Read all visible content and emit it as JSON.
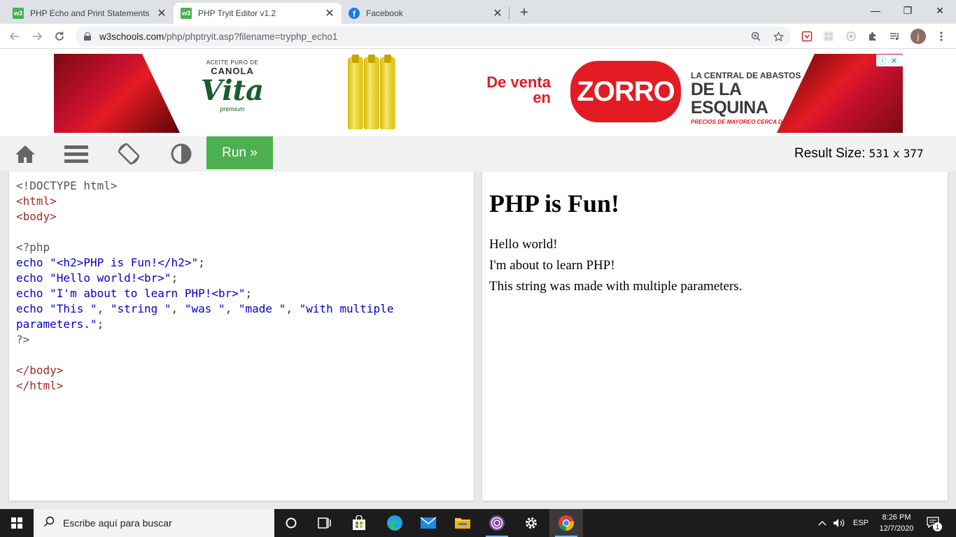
{
  "browser": {
    "tabs": [
      {
        "title": "PHP Echo and Print Statements",
        "favicon": "w3schools-icon",
        "active": false
      },
      {
        "title": "PHP Tryit Editor v1.2",
        "favicon": "w3schools-icon",
        "active": true
      },
      {
        "title": "Facebook",
        "favicon": "facebook-icon",
        "active": false
      }
    ],
    "favicon_w3_text": "w3",
    "favicon_fb_text": "f",
    "new_tab_label": "+",
    "close_glyph": "✕",
    "window": {
      "minimize": "—",
      "restore": "❐",
      "close": "✕"
    },
    "address": {
      "host": "w3schools.com",
      "path": "/php/phptryit.asp?filename=tryphp_echo1"
    },
    "profile_initial": "j"
  },
  "ad": {
    "brand_small": "ACEITE PURO DE",
    "brand_canola": "CANOLA",
    "brand_name": "Vita",
    "brand_premium": "premium",
    "de_venta": "De venta",
    "en": "en",
    "store": "ZORRO",
    "central_l1": "LA CENTRAL DE ABASTOS",
    "central_l2": "DE LA ESQUINA",
    "central_l3": "PRECIOS DE MAYOREO CERCA DE TI",
    "adchoices_info": "ⓘ",
    "adchoices_close": "✕",
    "colors": {
      "red": "#e31b23",
      "green": "#1a5c2e"
    }
  },
  "tryit": {
    "run_label": "Run »",
    "result_size_label": "Result Size:",
    "result_width": "531",
    "result_x": "x",
    "result_height": "377",
    "accent": "#4caf50"
  },
  "code_lines": [
    {
      "parts": [
        {
          "t": "<!DOCTYPE html>",
          "c": "c-gray"
        }
      ]
    },
    {
      "parts": [
        {
          "t": "<html>",
          "c": "c-tag"
        }
      ]
    },
    {
      "parts": [
        {
          "t": "<body>",
          "c": "c-tag"
        }
      ]
    },
    {
      "parts": [
        {
          "t": "",
          "c": "c-dark"
        }
      ]
    },
    {
      "parts": [
        {
          "t": "<?php",
          "c": "c-gray"
        }
      ]
    },
    {
      "parts": [
        {
          "t": "echo \"<h2>PHP is Fun!</h2>\"",
          "c": "c-blue"
        },
        {
          "t": ";",
          "c": "c-dark"
        }
      ]
    },
    {
      "parts": [
        {
          "t": "echo \"Hello world!<br>\"",
          "c": "c-blue"
        },
        {
          "t": ";",
          "c": "c-dark"
        }
      ]
    },
    {
      "parts": [
        {
          "t": "echo \"I'm about to learn PHP!<br>\"",
          "c": "c-blue"
        },
        {
          "t": ";",
          "c": "c-dark"
        }
      ]
    },
    {
      "parts": [
        {
          "t": "echo \"This \"",
          "c": "c-blue"
        },
        {
          "t": ", ",
          "c": "c-dark"
        },
        {
          "t": "\"string \"",
          "c": "c-blue"
        },
        {
          "t": ", ",
          "c": "c-dark"
        },
        {
          "t": "\"was \"",
          "c": "c-blue"
        },
        {
          "t": ", ",
          "c": "c-dark"
        },
        {
          "t": "\"made \"",
          "c": "c-blue"
        },
        {
          "t": ", ",
          "c": "c-dark"
        },
        {
          "t": "\"with multiple",
          "c": "c-blue"
        }
      ]
    },
    {
      "parts": [
        {
          "t": "parameters.\"",
          "c": "c-blue"
        },
        {
          "t": ";",
          "c": "c-dark"
        }
      ]
    },
    {
      "parts": [
        {
          "t": "?>",
          "c": "c-gray"
        }
      ]
    },
    {
      "parts": [
        {
          "t": "",
          "c": "c-dark"
        }
      ]
    },
    {
      "parts": [
        {
          "t": "</body>",
          "c": "c-tag"
        }
      ]
    },
    {
      "parts": [
        {
          "t": "</html>",
          "c": "c-tag"
        }
      ]
    }
  ],
  "result": {
    "heading": "PHP is Fun!",
    "lines": [
      "Hello world!",
      "I'm about to learn PHP!",
      "This string was made with multiple parameters."
    ]
  },
  "taskbar": {
    "search_placeholder": "Escribe aquí para buscar",
    "language": "ESP",
    "time": "8:26 PM",
    "date": "12/7/2020",
    "notification_count": "1"
  }
}
